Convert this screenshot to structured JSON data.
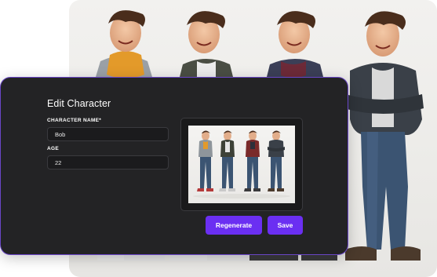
{
  "dialog": {
    "title": "Edit Character",
    "fields": {
      "name": {
        "label": "CHARACTER NAME*",
        "value": "Bob"
      },
      "age": {
        "label": "AGE",
        "value": "22"
      }
    },
    "buttons": {
      "regenerate": "Regenerate",
      "save": "Save"
    }
  },
  "colors": {
    "dialog_bg": "#232325",
    "accent": "#6b2ff2",
    "outline": "#6a46c8"
  },
  "preview": {
    "description_icons": [
      "character-turnaround-image"
    ]
  }
}
